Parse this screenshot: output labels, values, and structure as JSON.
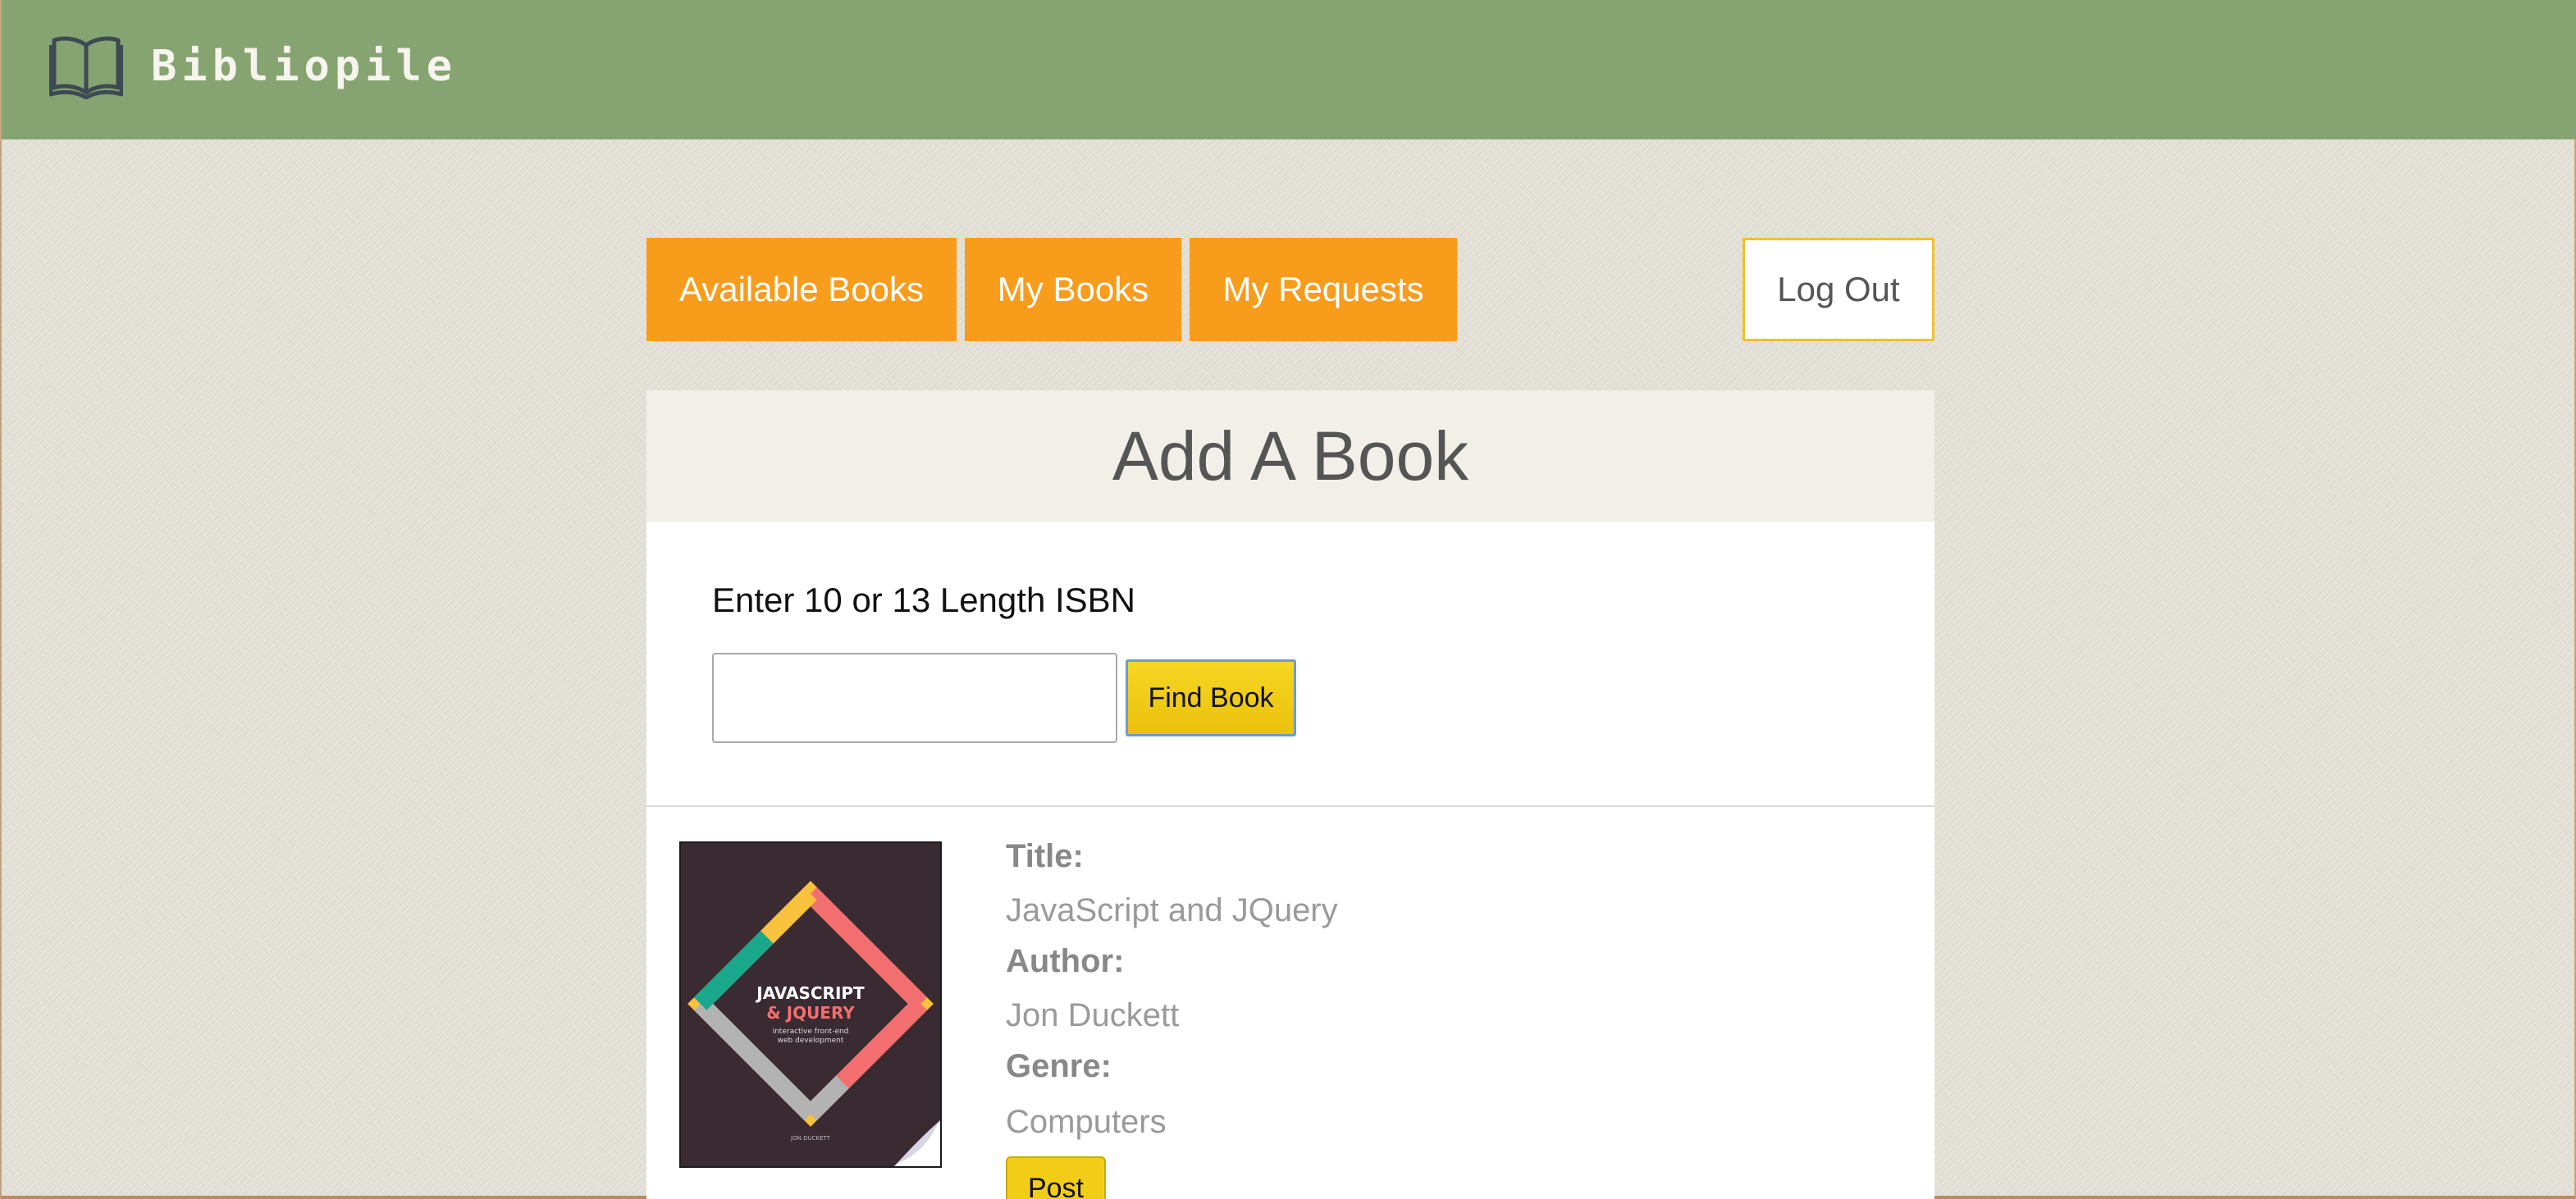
{
  "header": {
    "brand_name": "Bibliopile",
    "brand_icon": "open-book-icon"
  },
  "nav": {
    "available_books": "Available Books",
    "my_books": "My Books",
    "my_requests": "My Requests",
    "log_out": "Log Out"
  },
  "add_book": {
    "title": "Add A Book",
    "isbn_label": "Enter 10 or 13 Length ISBN",
    "isbn_value": "",
    "find_button": "Find Book"
  },
  "result": {
    "cover_title_line1": "JAVASCRIPT",
    "cover_title_line2": "& JQUERY",
    "cover_subtitle_line1": "interactive front-end",
    "cover_subtitle_line2": "web development",
    "cover_author": "JON DUCKETT",
    "title_label": "Title:",
    "title_value": "JavaScript and JQuery",
    "author_label": "Author:",
    "author_value": "Jon Duckett",
    "genre_label": "Genre:",
    "genre_value": "Computers",
    "post_button": "Post"
  },
  "colors": {
    "header_bg": "#86a471",
    "nav_orange": "#f89c1c",
    "button_yellow": "#f2cd18",
    "logout_border": "#f0c22c"
  }
}
